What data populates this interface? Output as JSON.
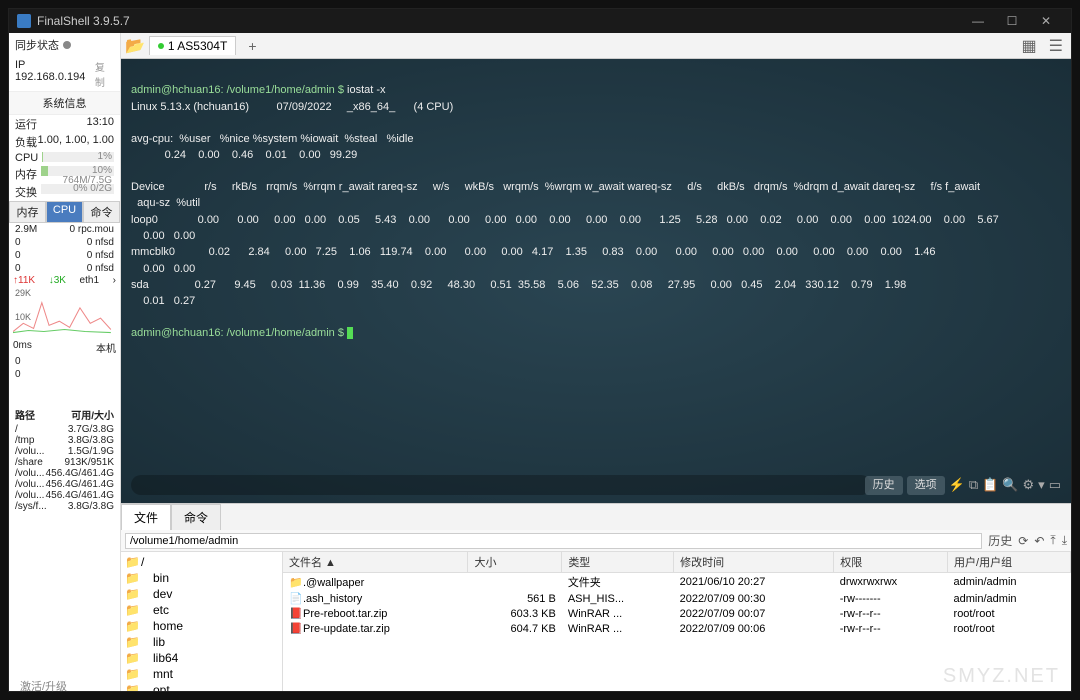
{
  "title": "FinalShell 3.9.5.7",
  "winbtns": {
    "min": "—",
    "max": "☐",
    "close": "✕"
  },
  "sidebar": {
    "sync": "同步状态",
    "ip": "IP 192.168.0.194",
    "copy": "复制",
    "sysinfo": "系统信息",
    "run_l": "运行",
    "run_v": "13:10",
    "load_l": "负载",
    "load_v": "1.00, 1.00, 1.00",
    "cpu_l": "CPU",
    "cpu_v": "1%",
    "mem_l": "内存",
    "mem_v": "10%  764M/7.5G",
    "swap_l": "交换",
    "swap_v": "0%        0/2G",
    "tabs": [
      "内存",
      "CPU",
      "命令"
    ],
    "procs": [
      [
        "2.9M",
        "0 rpc.mou"
      ],
      [
        "0",
        "0 nfsd"
      ],
      [
        "0",
        "0 nfsd"
      ],
      [
        "0",
        "0 nfsd"
      ]
    ],
    "net_up": "↑11K",
    "net_dn": "↓3K",
    "net_if": "eth1",
    "net_more": "›",
    "yticks": [
      "29K",
      "10K"
    ],
    "lat": "0ms",
    "lat_host": "本机",
    "lat_rows": [
      "0",
      "0"
    ],
    "disk_h": [
      "路径",
      "可用/大小"
    ],
    "disks": [
      [
        "/",
        "3.7G/3.8G"
      ],
      [
        "/tmp",
        "3.8G/3.8G"
      ],
      [
        "/volu...",
        "1.5G/1.9G"
      ],
      [
        "/share",
        "913K/951K"
      ],
      [
        "/volu...",
        "456.4G/461.4G"
      ],
      [
        "/volu...",
        "456.4G/461.4G"
      ],
      [
        "/volu...",
        "456.4G/461.4G"
      ],
      [
        "/sys/f...",
        "3.8G/3.8G"
      ]
    ],
    "activate": "激活/升级"
  },
  "tabbar": {
    "tab": "1 AS5304T"
  },
  "terminal": {
    "prompt": "admin@hchuan16: /volume1/home/admin $ ",
    "cmd": "iostat -x",
    "l2": "Linux 5.13.x (hchuan16)         07/09/2022     _x86_64_      (4 CPU)",
    "hdr1": "avg-cpu:  %user   %nice %system %iowait  %steal   %idle",
    "val1": "           0.24    0.00    0.46    0.01    0.00   99.29",
    "hdr2": "Device             r/s     rkB/s   rrqm/s  %rrqm r_await rareq-sz     w/s     wkB/s   wrqm/s  %wrqm w_await wareq-sz     d/s     dkB/s   drqm/s  %drqm d_await dareq-sz     f/s f_await",
    "hdr2b": "  aqu-sz  %util",
    "r1": "loop0             0.00      0.00     0.00   0.00    0.05     5.43    0.00      0.00     0.00   0.00    0.00     0.00    0.00      1.25     5.28   0.00    0.02     0.00    0.00    0.00  1024.00    0.00    5.67",
    "r1b": "    0.00   0.00",
    "r2": "mmcblk0           0.02      2.84     0.00   7.25    1.06   119.74    0.00      0.00     0.00   4.17    1.35     0.83    0.00      0.00     0.00   0.00    0.00     0.00    0.00    0.00    1.46",
    "r2b": "    0.00   0.00",
    "r3": "sda               0.27      9.45     0.03  11.36    0.99    35.40    0.92     48.30     0.51  35.58    5.06    52.35    0.08     27.95     0.00   0.45    2.04   330.12    0.79    1.98",
    "r3b": "    0.01   0.27",
    "foot": {
      "hist": "历史",
      "opt": "选项"
    }
  },
  "filepane": {
    "tabs": [
      "文件",
      "命令"
    ],
    "path": "/volume1/home/admin",
    "hist": "历史",
    "tree": [
      "/",
      "bin",
      "dev",
      "etc",
      "home",
      "lib",
      "lib64",
      "mnt",
      "opt"
    ],
    "cols": [
      "文件名 ▲",
      "大小",
      "类型",
      "修改时间",
      "权限",
      "用户/用户组"
    ],
    "rows": [
      {
        "ic": "📁",
        "n": ".@wallpaper",
        "s": "",
        "t": "文件夹",
        "m": "2021/06/10 20:27",
        "p": "drwxrwxrwx",
        "u": "admin/admin"
      },
      {
        "ic": "📄",
        "n": ".ash_history",
        "s": "561 B",
        "t": "ASH_HIS...",
        "m": "2022/07/09 00:30",
        "p": "-rw-------",
        "u": "admin/admin"
      },
      {
        "ic": "📕",
        "n": "Pre-reboot.tar.zip",
        "s": "603.3 KB",
        "t": "WinRAR ...",
        "m": "2022/07/09 00:07",
        "p": "-rw-r--r--",
        "u": "root/root"
      },
      {
        "ic": "📕",
        "n": "Pre-update.tar.zip",
        "s": "604.7 KB",
        "t": "WinRAR ...",
        "m": "2022/07/09 00:06",
        "p": "-rw-r--r--",
        "u": "root/root"
      }
    ]
  },
  "watermark": "SMYZ.NET"
}
